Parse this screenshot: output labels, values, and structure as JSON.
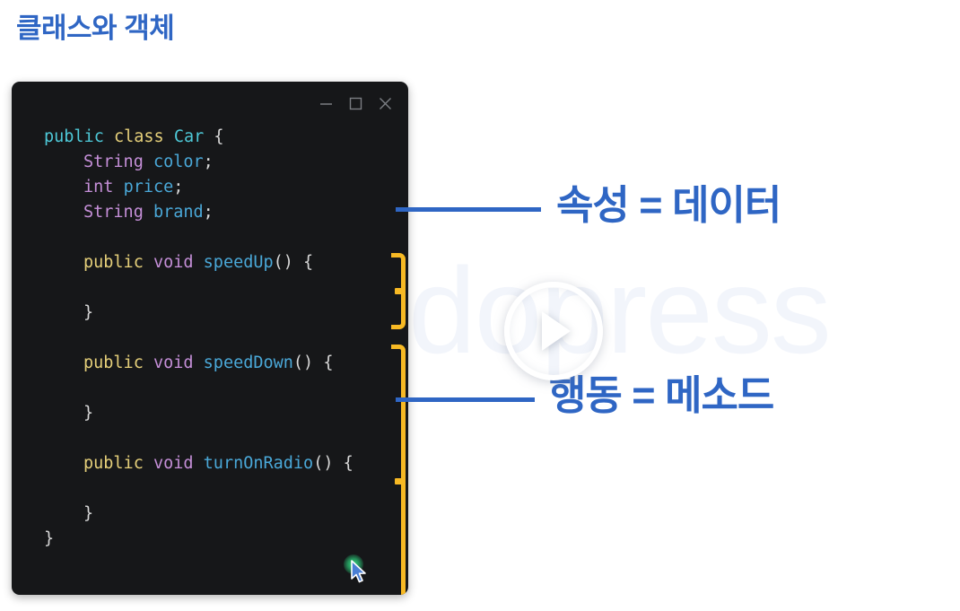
{
  "page": {
    "title": "클래스와 객체",
    "background_color": "#ffffff",
    "accent_color": "#2f66c4",
    "watermark_text": "dopress"
  },
  "code_window": {
    "background_color": "#161719",
    "controls": [
      {
        "name": "minimize",
        "glyph": "minimize-icon"
      },
      {
        "name": "maximize",
        "glyph": "maximize-icon"
      },
      {
        "name": "close",
        "glyph": "close-icon"
      }
    ],
    "language": "java",
    "lines": [
      {
        "indent": 0,
        "tokens": [
          {
            "text": "public",
            "color": "#4ec9d8"
          },
          {
            "text": " ",
            "color": "#d7d7d7"
          },
          {
            "text": "class",
            "color": "#e6d07a"
          },
          {
            "text": " ",
            "color": "#d7d7d7"
          },
          {
            "text": "Car",
            "color": "#4ec9d8"
          },
          {
            "text": " {",
            "color": "#d7d7d7"
          }
        ]
      },
      {
        "indent": 1,
        "tokens": [
          {
            "text": "String",
            "color": "#c58fd8"
          },
          {
            "text": " ",
            "color": "#d7d7d7"
          },
          {
            "text": "color",
            "color": "#4aa8d8"
          },
          {
            "text": ";",
            "color": "#d7d7d7"
          }
        ]
      },
      {
        "indent": 1,
        "tokens": [
          {
            "text": "int",
            "color": "#c58fd8"
          },
          {
            "text": " ",
            "color": "#d7d7d7"
          },
          {
            "text": "price",
            "color": "#4aa8d8"
          },
          {
            "text": ";",
            "color": "#d7d7d7"
          }
        ]
      },
      {
        "indent": 1,
        "tokens": [
          {
            "text": "String",
            "color": "#c58fd8"
          },
          {
            "text": " ",
            "color": "#d7d7d7"
          },
          {
            "text": "brand",
            "color": "#4aa8d8"
          },
          {
            "text": ";",
            "color": "#d7d7d7"
          }
        ]
      },
      {
        "indent": 0,
        "tokens": []
      },
      {
        "indent": 1,
        "tokens": [
          {
            "text": "public",
            "color": "#e6d07a"
          },
          {
            "text": " ",
            "color": "#d7d7d7"
          },
          {
            "text": "void",
            "color": "#c58fd8"
          },
          {
            "text": " ",
            "color": "#d7d7d7"
          },
          {
            "text": "speedUp",
            "color": "#4aa8d8"
          },
          {
            "text": "() {",
            "color": "#d7d7d7"
          }
        ]
      },
      {
        "indent": 0,
        "tokens": []
      },
      {
        "indent": 1,
        "tokens": [
          {
            "text": "}",
            "color": "#d7d7d7"
          }
        ]
      },
      {
        "indent": 0,
        "tokens": []
      },
      {
        "indent": 1,
        "tokens": [
          {
            "text": "public",
            "color": "#e6d07a"
          },
          {
            "text": " ",
            "color": "#d7d7d7"
          },
          {
            "text": "void",
            "color": "#c58fd8"
          },
          {
            "text": " ",
            "color": "#d7d7d7"
          },
          {
            "text": "speedDown",
            "color": "#4aa8d8"
          },
          {
            "text": "() {",
            "color": "#d7d7d7"
          }
        ]
      },
      {
        "indent": 0,
        "tokens": []
      },
      {
        "indent": 1,
        "tokens": [
          {
            "text": "}",
            "color": "#d7d7d7"
          }
        ]
      },
      {
        "indent": 0,
        "tokens": []
      },
      {
        "indent": 1,
        "tokens": [
          {
            "text": "public",
            "color": "#e6d07a"
          },
          {
            "text": " ",
            "color": "#d7d7d7"
          },
          {
            "text": "void",
            "color": "#c58fd8"
          },
          {
            "text": " ",
            "color": "#d7d7d7"
          },
          {
            "text": "turnOnRadio",
            "color": "#4aa8d8"
          },
          {
            "text": "() {",
            "color": "#d7d7d7"
          }
        ]
      },
      {
        "indent": 0,
        "tokens": []
      },
      {
        "indent": 1,
        "tokens": [
          {
            "text": "}",
            "color": "#d7d7d7"
          }
        ]
      },
      {
        "indent": 0,
        "tokens": [
          {
            "text": "}",
            "color": "#d7d7d7"
          }
        ]
      }
    ]
  },
  "annotations": {
    "bracket_color": "#f7b924",
    "line_color": "#2f66c4",
    "attributes": {
      "label": "속성 = 데이터"
    },
    "methods": {
      "label": "행동 = 메소드"
    }
  },
  "video_overlay": {
    "play_button_label": "play-button"
  },
  "cursor": {
    "click_indicator_color": "#2ddc82"
  }
}
